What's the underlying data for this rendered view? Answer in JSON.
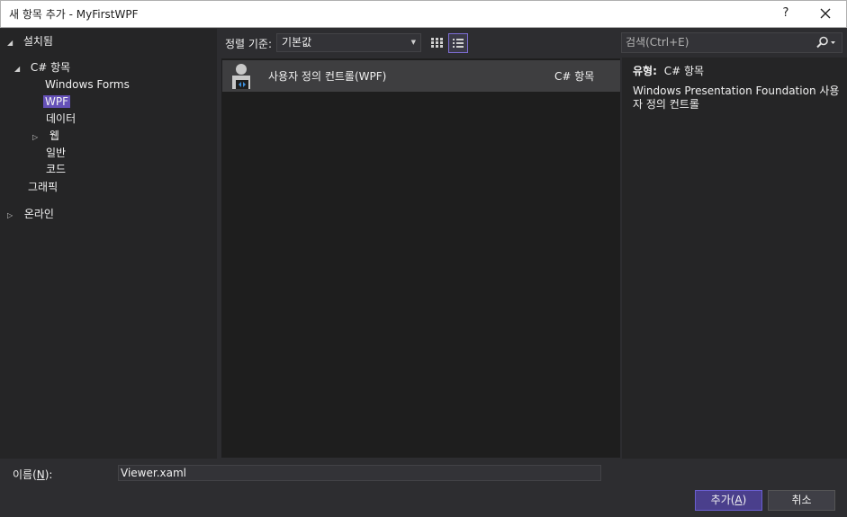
{
  "window": {
    "title": "새 항목 추가 - MyFirstWPF",
    "help": "?"
  },
  "tree": {
    "installed": "설치됨",
    "csharp": "C# 항목",
    "windows_forms": "Windows Forms",
    "wpf": "WPF",
    "data": "데이터",
    "web": "웹",
    "general": "일반",
    "code": "코드",
    "graphics": "그래픽",
    "online": "온라인"
  },
  "toolbar": {
    "sort_label": "정렬 기준:",
    "sort_value": "기본값"
  },
  "search": {
    "placeholder": "검색(Ctrl+E)"
  },
  "templates": [
    {
      "name": "사용자 정의 컨트롤(WPF)",
      "language": "C# 항목",
      "icon": "user-control-icon"
    }
  ],
  "details": {
    "type_label": "유형:",
    "type_value": "C# 항목",
    "description": "Windows Presentation Foundation 사용자 정의 컨트롤"
  },
  "footer": {
    "name_label_prefix": "이름(",
    "name_label_key": "N",
    "name_label_suffix": "):",
    "name_value": "Viewer.xaml",
    "add_prefix": "추가(",
    "add_key": "A",
    "add_suffix": ")",
    "cancel": "취소"
  },
  "colors": {
    "accent": "#6551b8",
    "background": "#2d2d30",
    "panel": "#252526"
  }
}
